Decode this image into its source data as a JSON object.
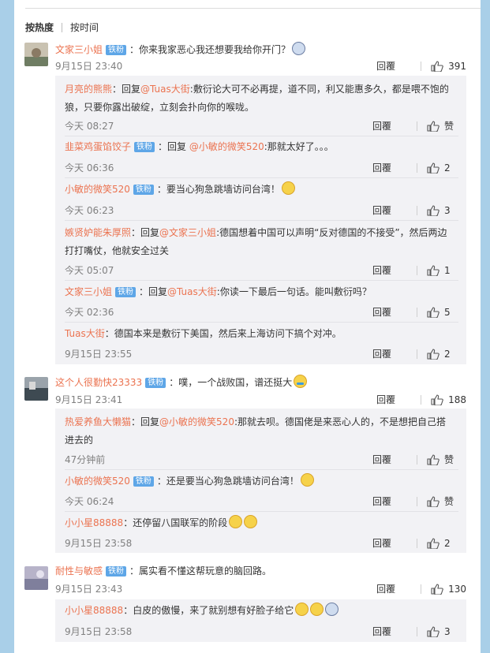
{
  "sort": {
    "hot": "按热度",
    "time": "按时间"
  },
  "colors": {
    "username": "#eb7350",
    "badge": "#5ea6e7",
    "timestamp": "#808080",
    "sub_bg": "#f2f2f5",
    "page_bg": "#a9cfe8"
  },
  "icons": {
    "like": "thumbs-up-icon",
    "emoji_face": "emoji-icon"
  },
  "comments": [
    {
      "user": "文家三小姐",
      "badge": "铁粉",
      "sep": "：",
      "text": "你来我家恶心我还想要我给你开门？",
      "time": "9月15日 23:40",
      "reply": "回覆",
      "likes": "391",
      "subs": [
        {
          "user": "月亮的熊熊",
          "sep": "：",
          "pre": "回复",
          "mention": "@Tuas大街",
          "text": ":敷衍论大可不必再提，道不同，利又能惠多久，都是喂不饱的狼，只要你露出破绽，立刻会扑向你的喉咙。",
          "time": "今天 08:27",
          "reply": "回覆",
          "likes": "赞"
        },
        {
          "user": "韭菜鸡蛋馅饺子",
          "badge": "铁粉",
          "sep": "：",
          "pre": "回复 ",
          "mention": "@小敏的微笑520",
          "text": ":那就太好了。。。",
          "time": "今天 06:36",
          "reply": "回覆",
          "likes": "2"
        },
        {
          "user": "小敏的微笑520",
          "badge": "铁粉",
          "sep": "：",
          "text": "要当心狗急跳墙访问台湾！",
          "time": "今天 06:23",
          "reply": "回覆",
          "likes": "3"
        },
        {
          "user": "嫉贤妒能朱厚照",
          "sep": "：",
          "pre": "回复",
          "mention": "@文家三小姐",
          "text": ":德国想着中国可以声明“反对德国的不接受”，然后两边打打嘴仗，他就安全过关",
          "time": "今天 05:07",
          "reply": "回覆",
          "likes": "1"
        },
        {
          "user": "文家三小姐",
          "badge": "铁粉",
          "sep": "：",
          "pre": "回复",
          "mention": "@Tuas大街",
          "text": ":你读一下最后一句话。能叫敷衍吗？",
          "time": "今天 02:36",
          "reply": "回覆",
          "likes": "5"
        },
        {
          "user": "Tuas大街",
          "sep": "：",
          "text": "德国本来是敷衍下美国，然后来上海访问下搞个对冲。",
          "time": "9月15日 23:55",
          "reply": "回覆",
          "likes": "2"
        }
      ]
    },
    {
      "user": "这个人很勤快23333",
      "badge": "铁粉",
      "sep": "：",
      "text": "噗，一个战败国，谱还挺大",
      "time": "9月15日 23:41",
      "reply": "回覆",
      "likes": "188",
      "subs": [
        {
          "user": "热爱养鱼大懒猫",
          "sep": "：",
          "pre": "回复",
          "mention": "@小敏的微笑520",
          "text": ":那就去呗。德国佬是来恶心人的，不是想把自己搭进去的",
          "time": "47分钟前",
          "reply": "回覆",
          "likes": "赞"
        },
        {
          "user": "小敏的微笑520",
          "badge": "铁粉",
          "sep": "：",
          "text": "还是要当心狗急跳墙访问台湾！",
          "time": "今天 06:24",
          "reply": "回覆",
          "likes": "赞"
        },
        {
          "user": "小小星88888",
          "sep": "：",
          "text": "还停留八国联军的阶段",
          "time": "9月15日 23:58",
          "reply": "回覆",
          "likes": "2"
        }
      ]
    },
    {
      "user": "耐性与敏感",
      "badge": "铁粉",
      "sep": "：",
      "text": "属实看不懂这帮玩意的脑回路。",
      "time": "9月15日 23:43",
      "reply": "回覆",
      "likes": "130",
      "subs": [
        {
          "user": "小小星88888",
          "sep": "：",
          "text": "白皮的傲慢，来了就别想有好脸子给它",
          "time": "9月15日 23:58",
          "reply": "回覆",
          "likes": "3"
        }
      ]
    }
  ]
}
